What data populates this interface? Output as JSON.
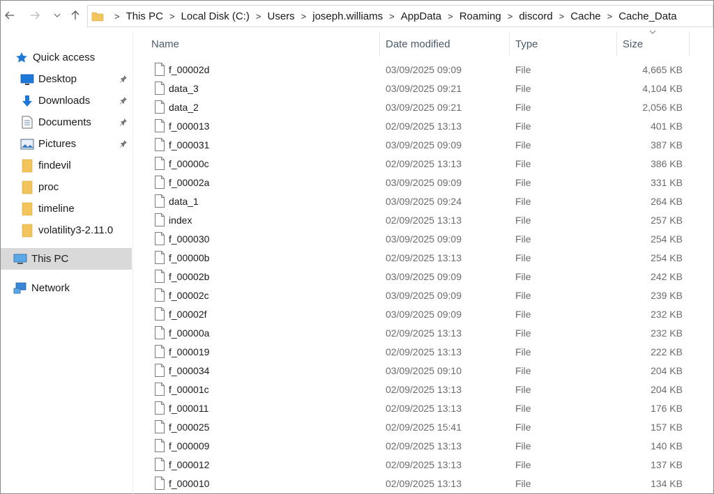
{
  "toolbar": {
    "back_icon": "arrow-left-icon",
    "forward_icon": "arrow-right-icon",
    "recent_icon": "chevron-down-icon",
    "up_icon": "arrow-up-icon"
  },
  "address": {
    "crumbs": [
      "This PC",
      "Local Disk (C:)",
      "Users",
      "joseph.williams",
      "AppData",
      "Roaming",
      "discord",
      "Cache",
      "Cache_Data"
    ]
  },
  "sidebar": {
    "items": [
      {
        "label": "Quick access",
        "icon": "star-icon",
        "pinned": false
      },
      {
        "label": "Desktop",
        "icon": "desktop-icon",
        "pinned": true
      },
      {
        "label": "Downloads",
        "icon": "download-icon",
        "pinned": true
      },
      {
        "label": "Documents",
        "icon": "document-icon",
        "pinned": true
      },
      {
        "label": "Pictures",
        "icon": "pictures-icon",
        "pinned": true
      },
      {
        "label": "findevil",
        "icon": "folder-icon",
        "pinned": false
      },
      {
        "label": "proc",
        "icon": "folder-icon",
        "pinned": false
      },
      {
        "label": "timeline",
        "icon": "folder-icon",
        "pinned": false
      },
      {
        "label": "volatility3-2.11.0",
        "icon": "folder-icon",
        "pinned": false
      },
      {
        "label": "This PC",
        "icon": "computer-icon",
        "pinned": false,
        "selected": true
      },
      {
        "label": "Network",
        "icon": "network-icon",
        "pinned": false
      }
    ]
  },
  "columns": {
    "name": "Name",
    "date": "Date modified",
    "type": "Type",
    "size": "Size"
  },
  "files": [
    {
      "name": "f_00002d",
      "date": "03/09/2025 09:09",
      "type": "File",
      "size": "4,665 KB"
    },
    {
      "name": "data_3",
      "date": "03/09/2025 09:21",
      "type": "File",
      "size": "4,104 KB"
    },
    {
      "name": "data_2",
      "date": "03/09/2025 09:21",
      "type": "File",
      "size": "2,056 KB"
    },
    {
      "name": "f_000013",
      "date": "02/09/2025 13:13",
      "type": "File",
      "size": "401 KB"
    },
    {
      "name": "f_000031",
      "date": "03/09/2025 09:09",
      "type": "File",
      "size": "387 KB"
    },
    {
      "name": "f_00000c",
      "date": "02/09/2025 13:13",
      "type": "File",
      "size": "386 KB"
    },
    {
      "name": "f_00002a",
      "date": "03/09/2025 09:09",
      "type": "File",
      "size": "331 KB"
    },
    {
      "name": "data_1",
      "date": "03/09/2025 09:24",
      "type": "File",
      "size": "264 KB"
    },
    {
      "name": "index",
      "date": "02/09/2025 13:13",
      "type": "File",
      "size": "257 KB"
    },
    {
      "name": "f_000030",
      "date": "03/09/2025 09:09",
      "type": "File",
      "size": "254 KB"
    },
    {
      "name": "f_00000b",
      "date": "02/09/2025 13:13",
      "type": "File",
      "size": "254 KB"
    },
    {
      "name": "f_00002b",
      "date": "03/09/2025 09:09",
      "type": "File",
      "size": "242 KB"
    },
    {
      "name": "f_00002c",
      "date": "03/09/2025 09:09",
      "type": "File",
      "size": "239 KB"
    },
    {
      "name": "f_00002f",
      "date": "03/09/2025 09:09",
      "type": "File",
      "size": "232 KB"
    },
    {
      "name": "f_00000a",
      "date": "02/09/2025 13:13",
      "type": "File",
      "size": "232 KB"
    },
    {
      "name": "f_000019",
      "date": "02/09/2025 13:13",
      "type": "File",
      "size": "222 KB"
    },
    {
      "name": "f_000034",
      "date": "03/09/2025 09:10",
      "type": "File",
      "size": "204 KB"
    },
    {
      "name": "f_00001c",
      "date": "02/09/2025 13:13",
      "type": "File",
      "size": "204 KB"
    },
    {
      "name": "f_000011",
      "date": "02/09/2025 13:13",
      "type": "File",
      "size": "176 KB"
    },
    {
      "name": "f_000025",
      "date": "02/09/2025 15:41",
      "type": "File",
      "size": "157 KB"
    },
    {
      "name": "f_000009",
      "date": "02/09/2025 13:13",
      "type": "File",
      "size": "140 KB"
    },
    {
      "name": "f_000012",
      "date": "02/09/2025 13:13",
      "type": "File",
      "size": "137 KB"
    },
    {
      "name": "f_000010",
      "date": "02/09/2025 13:13",
      "type": "File",
      "size": "134 KB"
    }
  ],
  "colors": {
    "folder": "#f2c55c",
    "selected_bg": "#d9d9d9",
    "accent_blue": "#1e78d7"
  }
}
